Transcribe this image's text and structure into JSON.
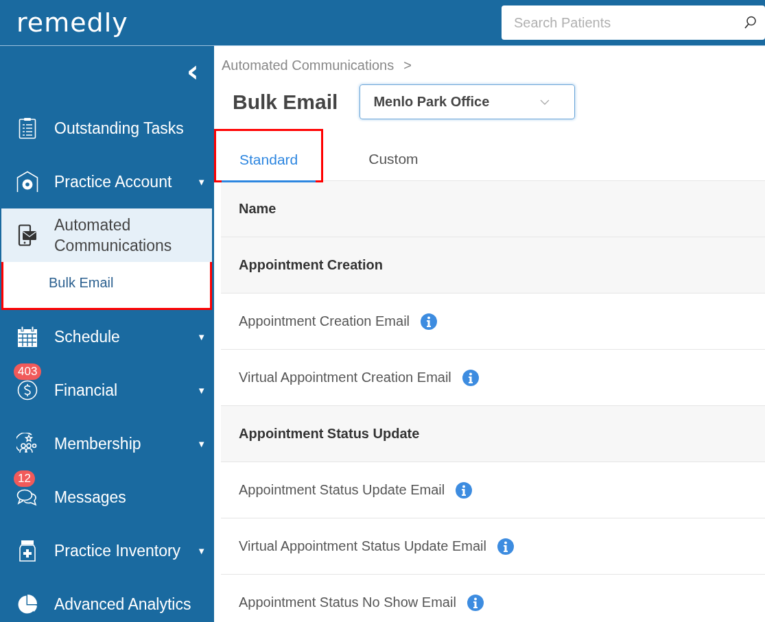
{
  "header": {
    "logo": "remedly",
    "search": {
      "placeholder": "Search Patients"
    }
  },
  "sidebar": {
    "collapse_icon": "‹",
    "items": [
      {
        "label": "Outstanding Tasks",
        "kind": "tasks",
        "selected": false,
        "highlighted": false
      },
      {
        "label": "Practice Account",
        "kind": "account",
        "caret": "▼",
        "selected": false,
        "highlighted": false
      },
      {
        "label": "Automated Communications",
        "kind": "phone-mail",
        "selected": true,
        "highlighted": true,
        "children": [
          {
            "label": "Bulk Email",
            "selected": true
          }
        ]
      },
      {
        "label": "Schedule",
        "kind": "calendar",
        "caret": "▼",
        "selected": false,
        "highlighted": false
      },
      {
        "label": "Financial",
        "kind": "dollar",
        "caret": "▼",
        "selected": false,
        "highlighted": false,
        "badge": "403"
      },
      {
        "label": "Membership",
        "kind": "members",
        "caret": "▼",
        "selected": false,
        "highlighted": false
      },
      {
        "label": "Messages",
        "kind": "chat",
        "selected": false,
        "highlighted": false,
        "badge": "12"
      },
      {
        "label": "Practice Inventory",
        "kind": "jar",
        "caret": "▼",
        "selected": false,
        "highlighted": false
      },
      {
        "label": "Advanced Analytics",
        "kind": "pie",
        "selected": false,
        "highlighted": false
      }
    ]
  },
  "breadcrumb": {
    "items": [
      "Automated Communications"
    ],
    "separator": ">"
  },
  "page_title": "Bulk Email",
  "location_dropdown": {
    "value": "Menlo Park Office"
  },
  "tabs": [
    {
      "label": "Standard",
      "selected": true,
      "highlighted": true
    },
    {
      "label": "Custom",
      "selected": false,
      "highlighted": false
    }
  ],
  "table": {
    "columns": [
      "Name"
    ],
    "rows": [
      {
        "kind": "group",
        "name": "Appointment Creation"
      },
      {
        "kind": "item",
        "name": "Appointment Creation Email"
      },
      {
        "kind": "item",
        "name": "Virtual Appointment Creation Email"
      },
      {
        "kind": "group",
        "name": "Appointment Status Update"
      },
      {
        "kind": "item",
        "name": "Appointment Status Update Email"
      },
      {
        "kind": "item",
        "name": "Virtual Appointment Status Update Email"
      },
      {
        "kind": "item",
        "name": "Appointment Status No Show Email"
      }
    ]
  }
}
